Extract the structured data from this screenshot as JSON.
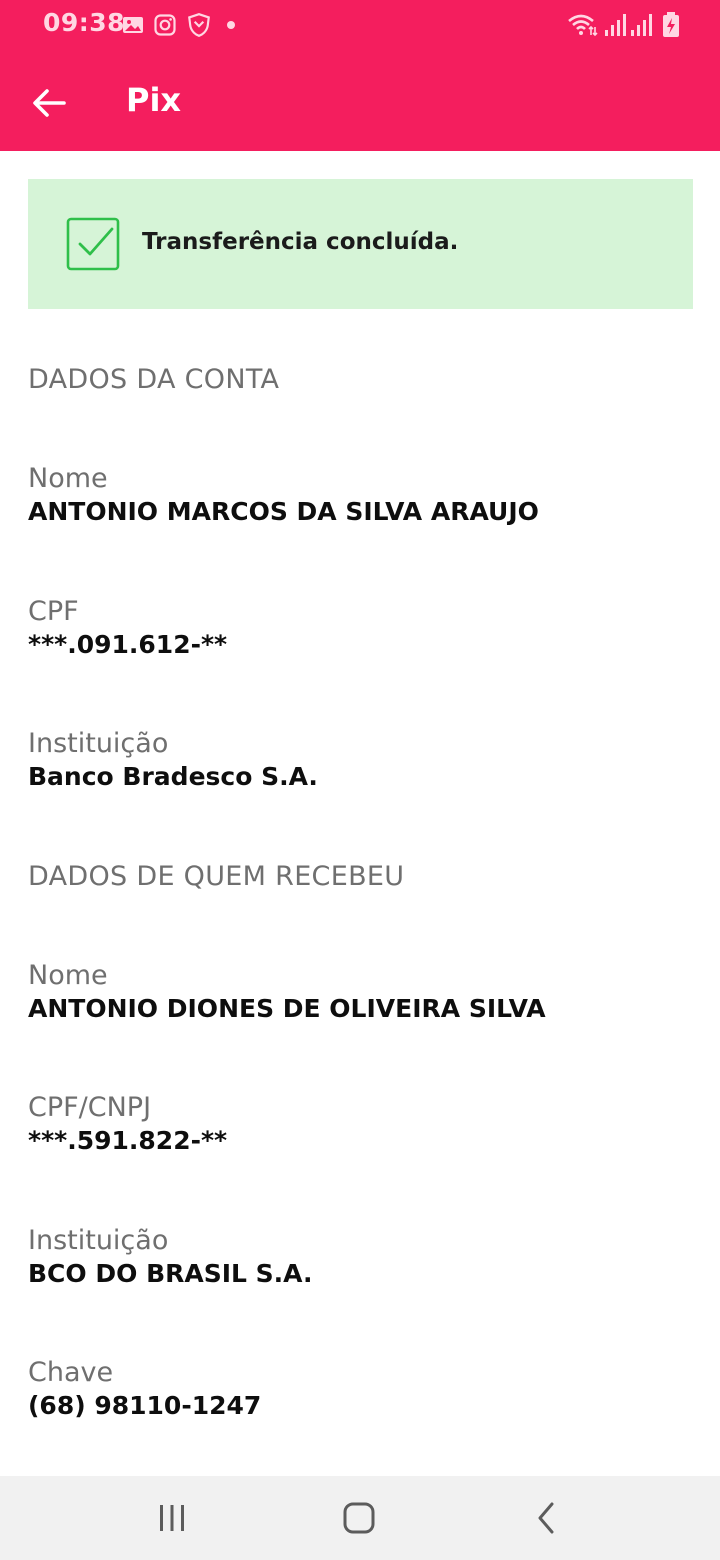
{
  "status_bar": {
    "time": "09:38"
  },
  "app_bar": {
    "title": "Pix"
  },
  "banner": {
    "message": "Transferência concluída."
  },
  "account": {
    "section_title": "DADOS DA CONTA",
    "fields": [
      {
        "label": "Nome",
        "value": "ANTONIO MARCOS DA SILVA ARAUJO"
      },
      {
        "label": "CPF",
        "value": "***.091.612-**"
      },
      {
        "label": "Instituição",
        "value": "Banco Bradesco S.A."
      }
    ]
  },
  "recipient": {
    "section_title": "DADOS DE QUEM RECEBEU",
    "fields": [
      {
        "label": "Nome",
        "value": "ANTONIO DIONES DE OLIVEIRA SILVA"
      },
      {
        "label": "CPF/CNPJ",
        "value": "***.591.822-**"
      },
      {
        "label": "Instituição",
        "value": "BCO DO BRASIL S.A."
      },
      {
        "label": "Chave",
        "value": "(68) 98110-1247"
      }
    ]
  },
  "colors": {
    "brand": "#f41e5e",
    "success_bg": "#d6f4d7",
    "success_icon": "#2fbf4a"
  },
  "icons": {
    "status": [
      "gallery-icon",
      "instagram-icon",
      "shield-app-icon",
      "dot-icon",
      "wifi-icon",
      "signal-icon",
      "signal-icon-2",
      "battery-charging-icon"
    ],
    "nav": [
      "recents-icon",
      "home-icon",
      "back-nav-icon"
    ]
  }
}
